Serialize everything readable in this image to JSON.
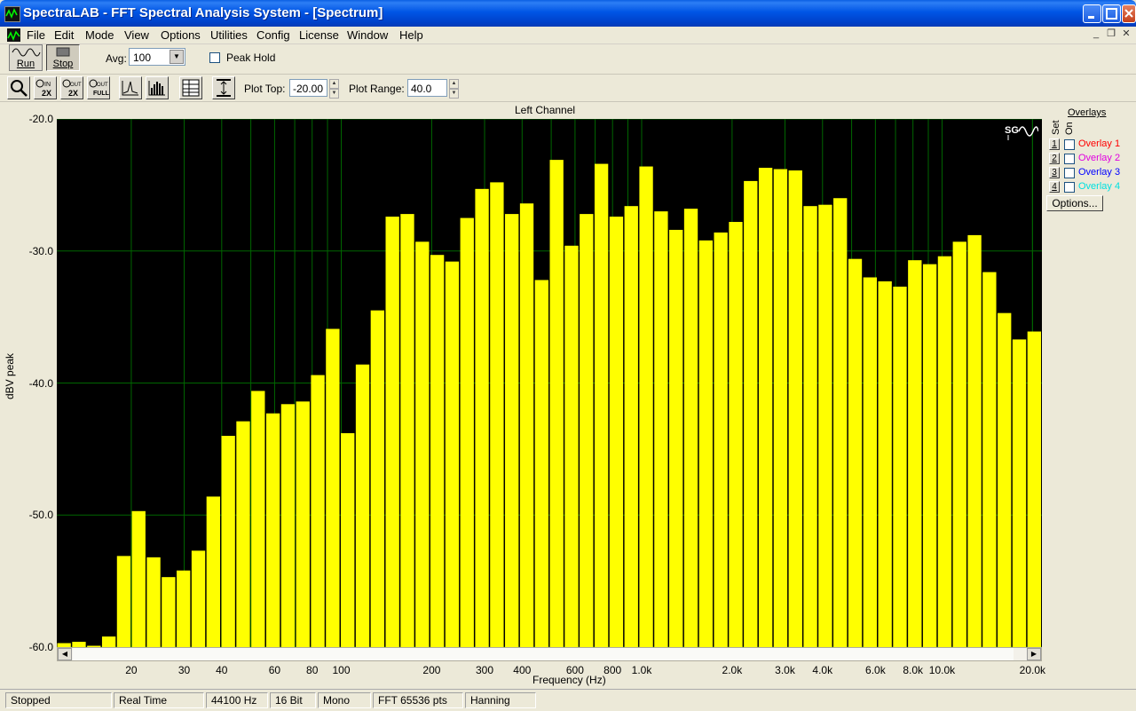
{
  "window": {
    "title": "SpectraLAB - FFT Spectral Analysis System - [Spectrum]"
  },
  "menu": [
    "File",
    "Edit",
    "Mode",
    "View",
    "Options",
    "Utilities",
    "Config",
    "License",
    "Window",
    "Help"
  ],
  "toolbar": {
    "run_label": "Run",
    "stop_label": "Stop",
    "avg_label": "Avg:",
    "avg_value": "100",
    "peak_hold_label": "Peak Hold"
  },
  "toolbar2": {
    "zoom_in_label": "IN 2X",
    "zoom_out_label": "OUT 2X",
    "zoom_full_label": "OUT FULL",
    "plot_top_label": "Plot Top:",
    "plot_top_value": "-20.00",
    "plot_range_label": "Plot Range:",
    "plot_range_value": "40.0"
  },
  "overlays": {
    "title": "Overlays",
    "set_label": "Set",
    "on_label": "On",
    "items": [
      {
        "num": "1",
        "label": "Overlay 1",
        "color": "#ff0000"
      },
      {
        "num": "2",
        "label": "Overlay 2",
        "color": "#e000e0"
      },
      {
        "num": "3",
        "label": "Overlay 3",
        "color": "#0000ff"
      },
      {
        "num": "4",
        "label": "Overlay 4",
        "color": "#00e0e0"
      }
    ],
    "options_label": "Options..."
  },
  "status": [
    "Stopped",
    "Real Time",
    "44100 Hz",
    "16 Bit",
    "Mono",
    "FFT 65536 pts",
    "Hanning"
  ],
  "chart_data": {
    "type": "bar",
    "title": "Left Channel",
    "xlabel": "Frequency (Hz)",
    "ylabel": "dBV peak",
    "x_scale": "log",
    "ylim": [
      -60,
      -20
    ],
    "y_ticks": [
      "-20.0",
      "-30.0",
      "-40.0",
      "-50.0",
      "-60.0"
    ],
    "x_ticks": [
      "20",
      "30",
      "40",
      "60",
      "80",
      "100",
      "200",
      "300",
      "400",
      "600",
      "800",
      "1.0k",
      "2.0k",
      "3.0k",
      "4.0k",
      "6.0k",
      "8.0k",
      "10.0k",
      "20.0k"
    ],
    "bar_color": "#ffff00",
    "grid_color": "#006600",
    "values": [
      -59.7,
      -59.6,
      -59.9,
      -59.2,
      -53.1,
      -49.7,
      -53.2,
      -54.7,
      -54.2,
      -52.7,
      -48.6,
      -44.0,
      -42.9,
      -40.6,
      -42.3,
      -41.6,
      -41.4,
      -39.4,
      -35.9,
      -43.8,
      -38.6,
      -34.5,
      -27.4,
      -27.2,
      -29.3,
      -30.3,
      -30.8,
      -27.5,
      -25.3,
      -24.8,
      -27.2,
      -26.4,
      -32.2,
      -23.1,
      -29.6,
      -27.2,
      -23.4,
      -27.4,
      -26.6,
      -23.6,
      -27.0,
      -28.4,
      -26.8,
      -29.2,
      -28.6,
      -27.8,
      -24.7,
      -23.7,
      -23.8,
      -23.9,
      -26.6,
      -26.5,
      -26.0,
      -30.6,
      -32.0,
      -32.3,
      -32.7,
      -30.7,
      -31.0,
      -30.4,
      -29.3,
      -28.8,
      -31.6,
      -34.7,
      -36.7,
      -36.1
    ]
  }
}
